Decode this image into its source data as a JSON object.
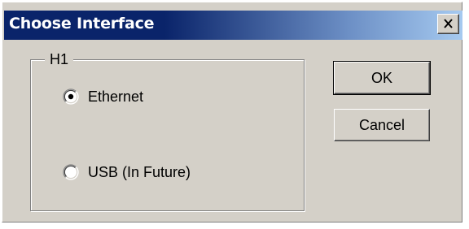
{
  "window": {
    "title": "Choose Interface",
    "close_label": "X"
  },
  "group": {
    "label": "H1",
    "options": [
      {
        "label": "Ethernet",
        "selected": true
      },
      {
        "label": "USB (In Future)",
        "selected": false
      }
    ]
  },
  "buttons": {
    "ok_label": "OK",
    "cancel_label": "Cancel"
  },
  "colors": {
    "face": "#d4d0c8",
    "title_start": "#0a246a",
    "title_end": "#a6caf0"
  },
  "icons": {
    "close": "close-icon",
    "radio_selected": "radio-selected-icon",
    "radio_unselected": "radio-unselected-icon"
  }
}
